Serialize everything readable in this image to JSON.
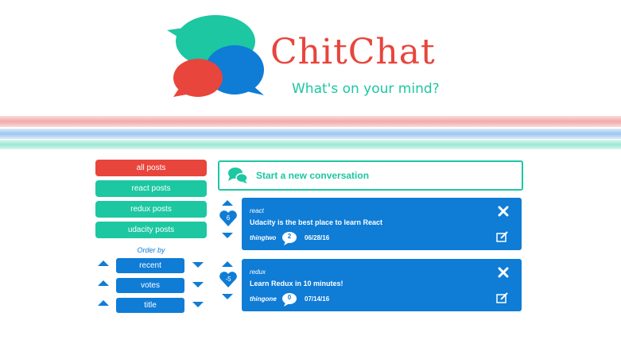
{
  "header": {
    "app_title": "ChitChat",
    "tagline": "What's on your mind?"
  },
  "sidebar": {
    "categories": [
      {
        "label": "all posts",
        "active": true
      },
      {
        "label": "react posts",
        "active": false
      },
      {
        "label": "redux posts",
        "active": false
      },
      {
        "label": "udacity posts",
        "active": false
      }
    ],
    "order_by_label": "Order by",
    "sort_options": [
      {
        "label": "recent"
      },
      {
        "label": "votes"
      },
      {
        "label": "title"
      }
    ]
  },
  "new_conversation": {
    "label": "Start a new conversation",
    "icon": "chat-bubbles-icon"
  },
  "posts": [
    {
      "category": "react",
      "title": "Udacity is the best place to learn React",
      "author": "thingtwo",
      "comment_count": "2",
      "date": "06/28/16",
      "vote_score": "6"
    },
    {
      "category": "redux",
      "title": "Learn Redux in 10 minutes!",
      "author": "thingone",
      "comment_count": "0",
      "date": "07/14/16",
      "vote_score": "-5"
    }
  ],
  "colors": {
    "brand_red": "#e8453c",
    "brand_teal": "#1cc7a1",
    "brand_blue": "#0f7cd6"
  }
}
